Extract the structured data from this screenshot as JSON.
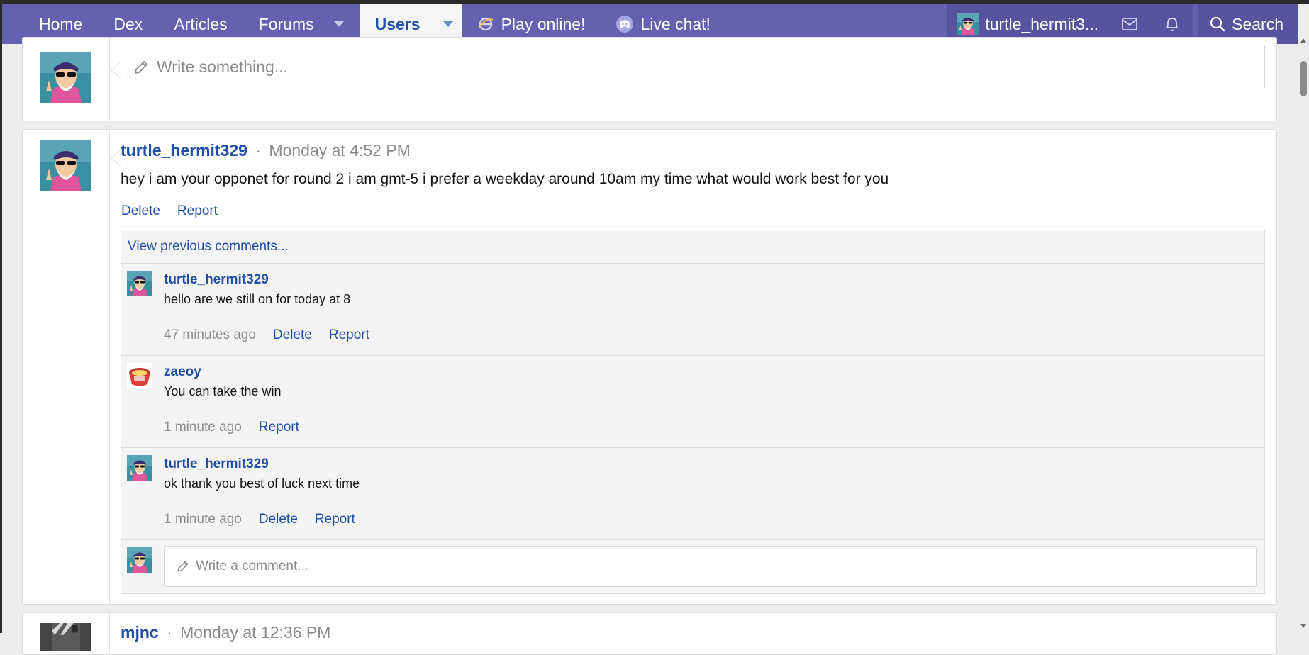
{
  "nav": {
    "items": [
      {
        "label": "Home"
      },
      {
        "label": "Dex"
      },
      {
        "label": "Articles"
      },
      {
        "label": "Forums"
      },
      {
        "label": "Users"
      },
      {
        "label": "Play online!"
      },
      {
        "label": "Live chat!"
      }
    ],
    "account_name": "turtle_hermit3...",
    "search_label": "Search"
  },
  "status_composer": {
    "placeholder": "Write something..."
  },
  "post": {
    "author": "turtle_hermit329",
    "separator": "·",
    "time": "Monday at 4:52 PM",
    "body": "hey i am your opponet for round 2 i am gmt-5 i prefer a weekday around 10am my time what would work best for you",
    "delete_label": "Delete",
    "report_label": "Report",
    "view_previous": "View previous comments...",
    "comments": [
      {
        "author": "turtle_hermit329",
        "text": "hello are we still on for today at 8",
        "time": "47 minutes ago",
        "delete_label": "Delete",
        "report_label": "Report"
      },
      {
        "author": "zaeoy",
        "text": "You can take the win",
        "time": "1 minute ago",
        "report_label": "Report"
      },
      {
        "author": "turtle_hermit329",
        "text": "ok thank you best of luck next time",
        "time": "1 minute ago",
        "delete_label": "Delete",
        "report_label": "Report"
      }
    ],
    "comment_placeholder": "Write a comment..."
  },
  "next_post": {
    "author": "mjnc",
    "separator": "·",
    "time": "Monday at 12:36 PM"
  }
}
